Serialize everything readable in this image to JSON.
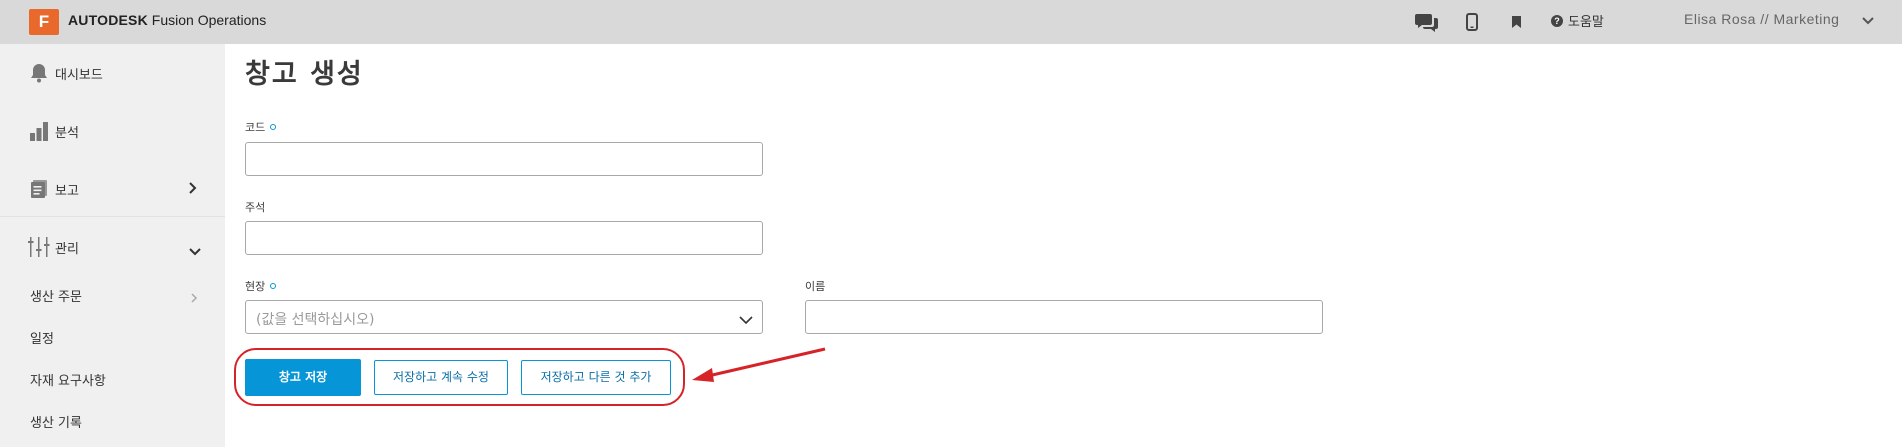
{
  "topbar": {
    "logo_letter": "F",
    "brand_bold": "AUTODESK",
    "brand_product": "Fusion Operations",
    "icons": [
      "chat-icon",
      "mobile-icon",
      "bookmark-icon"
    ],
    "help_label": "도움말",
    "user_label": "Elisa Rosa // Marketing"
  },
  "sidebar": {
    "items": [
      {
        "label": "대시보드",
        "icon": "bell-icon"
      },
      {
        "label": "분석",
        "icon": "bar-chart-icon"
      },
      {
        "label": "보고",
        "icon": "report-icon"
      },
      {
        "label": "관리",
        "icon": "sliders-icon"
      }
    ],
    "sub_items": [
      {
        "label": "생산 주문"
      },
      {
        "label": "일정"
      },
      {
        "label": "자재 요구사항"
      },
      {
        "label": "생산 기록"
      }
    ]
  },
  "form": {
    "title": "창고 생성",
    "code_label": "코드",
    "note_label": "주석",
    "site_label": "현장",
    "site_placeholder": "(값을 선택하십시오)",
    "name_label": "이름"
  },
  "actions": {
    "save_label": "창고 저장",
    "save_continue_label": "저장하고 계속 수정",
    "save_add_label": "저장하고 다른 것 추가"
  },
  "colors": {
    "accent": "#0696d7",
    "annotation": "#d62328",
    "logo": "#e8692b"
  }
}
